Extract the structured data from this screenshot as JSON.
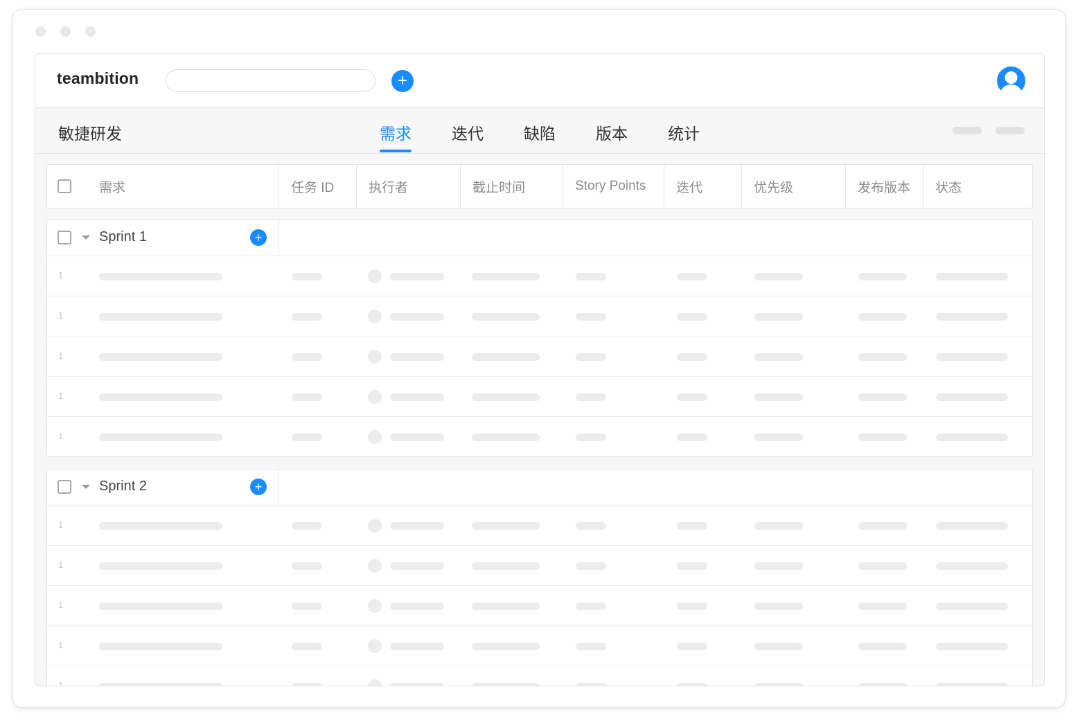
{
  "window": {
    "dots": [
      "close",
      "minimize",
      "maximize"
    ]
  },
  "topbar": {
    "logo": "teambition",
    "search": {
      "placeholder": "",
      "value": ""
    },
    "add_button_icon": "plus-icon",
    "avatar_icon": "user-avatar-icon"
  },
  "navbar": {
    "project_title": "敏捷研发",
    "tabs": [
      {
        "label": "需求",
        "active": true
      },
      {
        "label": "迭代",
        "active": false
      },
      {
        "label": "缺陷",
        "active": false
      },
      {
        "label": "版本",
        "active": false
      },
      {
        "label": "统计",
        "active": false
      }
    ]
  },
  "table": {
    "columns": [
      "需求",
      "任务 ID",
      "执行者",
      "截止时间",
      "Story Points",
      "迭代",
      "优先级",
      "发布版本",
      "状态"
    ]
  },
  "groups": [
    {
      "name": "Sprint 1",
      "rows": [
        "1",
        "1",
        "1",
        "1",
        "1"
      ]
    },
    {
      "name": "Sprint 2",
      "rows": [
        "1",
        "1",
        "1",
        "1",
        "1"
      ]
    }
  ],
  "colors": {
    "accent": "#1b8cff",
    "placeholder_bar": "#ececec"
  }
}
